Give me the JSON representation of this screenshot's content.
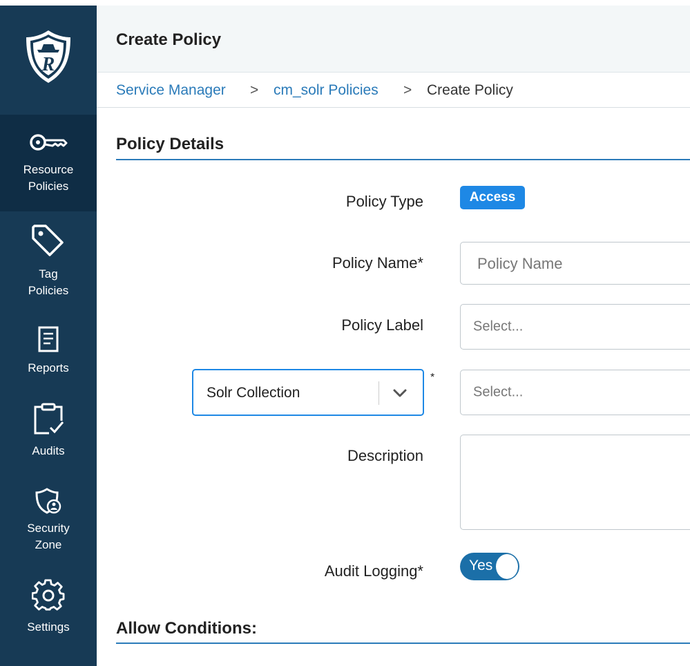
{
  "sidebar": {
    "items": [
      {
        "label": "Resource Policies",
        "line1": "Resource",
        "line2": "Policies",
        "icon": "key-icon",
        "active": true
      },
      {
        "label": "Tag Policies",
        "line1": "Tag",
        "line2": "Policies",
        "icon": "tag-icon"
      },
      {
        "label": "Reports",
        "icon": "report-icon"
      },
      {
        "label": "Audits",
        "icon": "clipboard-check-icon"
      },
      {
        "label": "Security Zone",
        "line1": "Security",
        "line2": "Zone",
        "icon": "shield-user-icon"
      },
      {
        "label": "Settings",
        "icon": "gear-icon"
      }
    ]
  },
  "header": {
    "title": "Create Policy"
  },
  "breadcrumb": {
    "items": [
      "Service Manager",
      "cm_solr Policies",
      "Create Policy"
    ],
    "separator": ">"
  },
  "policy_details": {
    "title": "Policy Details",
    "policy_type_label": "Policy Type",
    "policy_type_value": "Access",
    "policy_name_label": "Policy Name*",
    "policy_name_placeholder": "Policy Name",
    "policy_label_label": "Policy Label",
    "policy_label_placeholder": "Select...",
    "resource_type_value": "Solr Collection",
    "resource_required_mark": "*",
    "resource_value_placeholder": "Select...",
    "description_label": "Description",
    "audit_logging_label": "Audit Logging*",
    "audit_logging_value": "Yes"
  },
  "allow_conditions": {
    "title": "Allow Conditions:"
  },
  "colors": {
    "sidebar_bg": "#173a55",
    "sidebar_active": "#0f2d45",
    "accent": "#2b7bb9",
    "badge": "#1e88e5",
    "toggle": "#1b6fa8"
  }
}
